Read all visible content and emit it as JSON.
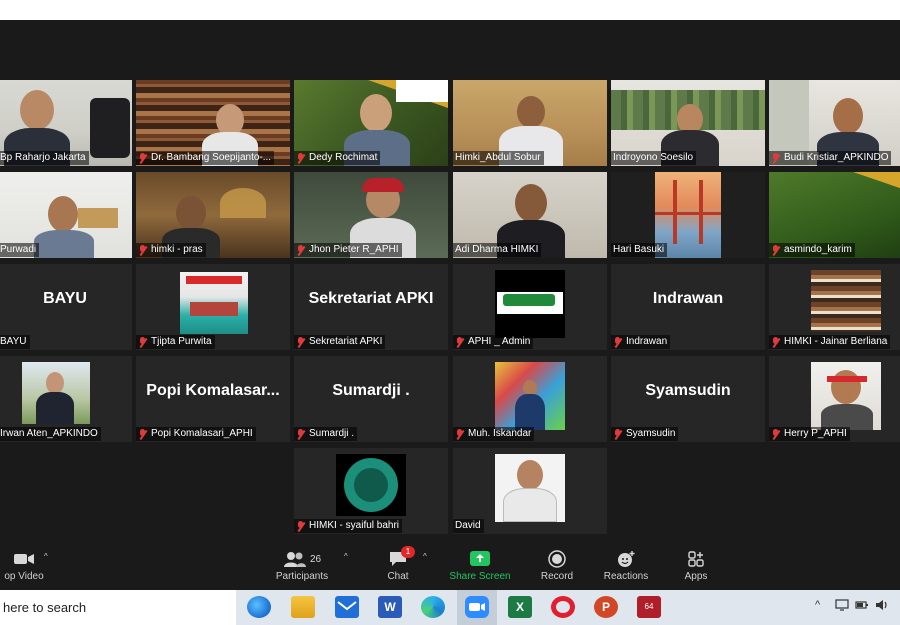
{
  "participants": [
    {
      "name": "Bp Raharjo Jakarta",
      "muted": false
    },
    {
      "name": "Dr. Bambang Soepijanto-...",
      "muted": true
    },
    {
      "name": "Dedy Rochimat",
      "muted": true
    },
    {
      "name": "Himki_Abdul Sobur",
      "muted": false
    },
    {
      "name": "Indroyono Soesilo",
      "muted": false,
      "active_speaker": true
    },
    {
      "name": "Budi Kristiar_APKINDO",
      "muted": true
    },
    {
      "name": "Purwadi",
      "muted": false
    },
    {
      "name": "himki - pras",
      "muted": true
    },
    {
      "name": "Jhon Pieter R_APHI",
      "muted": true
    },
    {
      "name": "Adi Dharma HIMKI",
      "muted": false
    },
    {
      "name": "Hari Basuki",
      "muted": false
    },
    {
      "name": "asmindo_karim",
      "muted": true
    },
    {
      "name": "BAYU",
      "muted": false,
      "display_text": "BAYU"
    },
    {
      "name": "Tjipta Purwita",
      "muted": true
    },
    {
      "name": "Sekretariat APKI",
      "muted": true,
      "display_text": "Sekretariat APKI"
    },
    {
      "name": "APHI _ Admin",
      "muted": true
    },
    {
      "name": "Indrawan",
      "muted": true,
      "display_text": "Indrawan"
    },
    {
      "name": "HIMKI - Jainar Berliana",
      "muted": true
    },
    {
      "name": "Irwan Aten_APKINDO",
      "muted": false
    },
    {
      "name": "Popi Komalasari_APHI",
      "muted": true,
      "display_text": "Popi  Komalasar..."
    },
    {
      "name": "Sumardji .",
      "muted": true,
      "display_text": "Sumardji ."
    },
    {
      "name": "Muh. Iskandar",
      "muted": true
    },
    {
      "name": "Syamsudin",
      "muted": true,
      "display_text": "Syamsudin"
    },
    {
      "name": "Herry P_APHI",
      "muted": true
    },
    {
      "name": "HIMKI - syaiful bahri",
      "muted": true
    },
    {
      "name": "David",
      "muted": false
    }
  ],
  "toolbar": {
    "video_label": "op Video",
    "participants_label": "Participants",
    "participants_count": "26",
    "chat_label": "Chat",
    "chat_badge": "1",
    "share_label": "Share Screen",
    "record_label": "Record",
    "reactions_label": "Reactions",
    "apps_label": "Apps"
  },
  "taskbar": {
    "search_text": "here to search",
    "apps": [
      "edge-legacy",
      "file-explorer",
      "mail",
      "word",
      "edge",
      "zoom",
      "excel",
      "opera",
      "powerpoint",
      "other"
    ],
    "opera_badge": "64"
  },
  "colors": {
    "background": "#1a1a1a",
    "active_speaker": "#9ed44d",
    "share_green": "#22c55e",
    "mute_red": "#e03a3a",
    "badge_red": "#e02828"
  }
}
